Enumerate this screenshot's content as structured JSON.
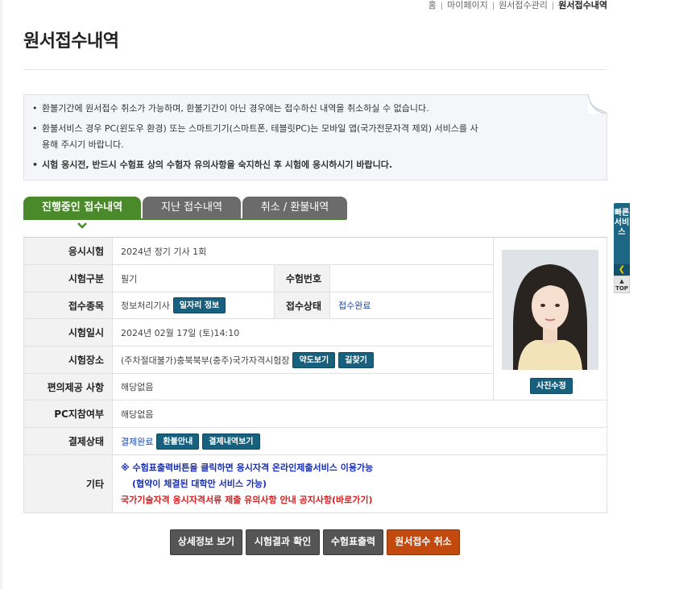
{
  "breadcrumb": {
    "items": [
      "홈",
      "마이페이지",
      "원서접수관리"
    ],
    "current": "원서접수내역"
  },
  "page_title": "원서접수내역",
  "notice": {
    "items": [
      "환불기간에 원서접수 취소가 가능하며, 환불기간이 아닌 경우에는 접수하신 내역을 취소하실 수 없습니다.",
      "환불서비스 경우 PC(윈도우 환경) 또는 스마트기기(스마트폰, 테블릿PC)는 모바일 앱(국가전문자격 제외) 서비스를 사용해 주시기 바랍니다.",
      "시험 응시전, 반드시 수험표 상의 수험자 유의사항을 숙지하신 후 시험에 응시하시기 바랍니다."
    ]
  },
  "tabs": [
    {
      "label": "진행중인 접수내역",
      "active": true
    },
    {
      "label": "지난 접수내역",
      "active": false
    },
    {
      "label": "취소 / 환불내역",
      "active": false
    }
  ],
  "details": {
    "exam": {
      "label": "응시시험",
      "value": "2024년 정기 기사 1회"
    },
    "category": {
      "label": "시험구분",
      "value": "필기"
    },
    "exam_number": {
      "label": "수험번호",
      "value": ""
    },
    "item": {
      "label": "접수종목",
      "value": "정보처리기사",
      "button": "일자리 정보"
    },
    "status": {
      "label": "접수상태",
      "value": "접수완료"
    },
    "datetime": {
      "label": "시험일시",
      "value": "2024년 02월 17일 (토)14:10"
    },
    "place": {
      "label": "시험장소",
      "value": "(주차절대불가)충북북부(충주)국가자격시험장",
      "btn_map": "약도보기",
      "btn_route": "길찾기"
    },
    "convenience": {
      "label": "편의제공 사항",
      "value": "해당없음"
    },
    "pc": {
      "label": "PC지참여부",
      "value": "해당없음"
    },
    "payment": {
      "label": "결제상태",
      "value": "결제완료",
      "btn_refund": "환불안내",
      "btn_history": "결제내역보기"
    },
    "etc": {
      "label": "기타",
      "line1": "※ 수험표출력버튼을 클릭하면 응시자격 온라인제출서비스 이용가능",
      "line2": "(협약이 체결된 대학만 서비스 가능)",
      "line3": "국가기술자격 응시자격서류 제출 유의사항 안내 공지사항(바로가기)"
    },
    "photo_button": "사진수정"
  },
  "actions": {
    "detail": "상세정보 보기",
    "result": "시험결과 확인",
    "print": "수험표출력",
    "cancel": "원서접수 취소"
  },
  "quick_menu": {
    "label": "빠른서비스",
    "top": "TOP"
  },
  "colors": {
    "tab_active": "#4a8a2a",
    "tab_inactive": "#6b6b6b",
    "button_teal": "#17607e",
    "cancel_orange": "#c34a0e",
    "link_blue": "#1a47a8",
    "notice_red": "#d42020"
  }
}
